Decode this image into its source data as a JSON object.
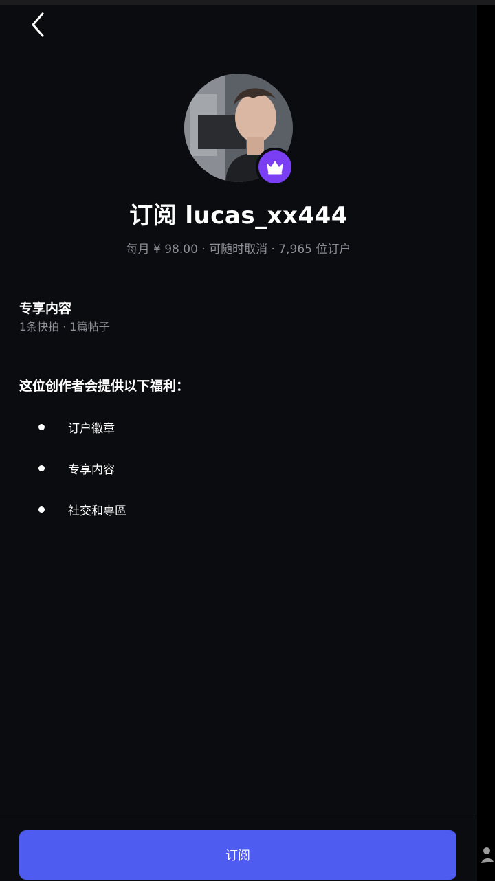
{
  "header": {
    "back_icon": "chevron-left-icon"
  },
  "profile": {
    "avatar_icon": "avatar-photo",
    "badge_icon": "crown-icon",
    "badge_color": "#7a3ff2",
    "title": "订阅 lucas_xx444",
    "meta": "每月 ¥ 98.00 · 可随时取消 · 7,965 位订户"
  },
  "exclusive": {
    "heading": "专享内容",
    "summary": "1条快拍 · 1篇帖子"
  },
  "benefits": {
    "heading": "这位创作者会提供以下福利：",
    "items": [
      {
        "label": "订户徽章"
      },
      {
        "label": "专享内容"
      },
      {
        "label": "社交和專區"
      }
    ]
  },
  "footer": {
    "subscribe_label": "订阅",
    "button_color": "#4f5cf0"
  }
}
